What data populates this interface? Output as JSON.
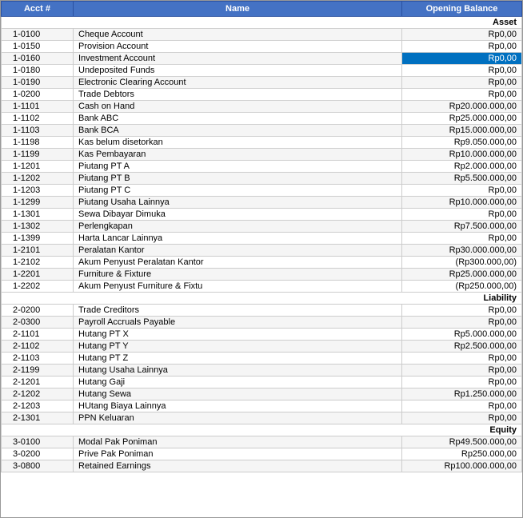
{
  "header": {
    "col1": "Acct #",
    "col2": "Name",
    "col3": "Opening Balance"
  },
  "rows": [
    {
      "type": "category",
      "col1": "Asset",
      "col2": "",
      "col3": ""
    },
    {
      "type": "data",
      "col1": "1-0100",
      "col2": "Cheque Account",
      "col3": "Rp0,00"
    },
    {
      "type": "data",
      "col1": "1-0150",
      "col2": "Provision Account",
      "col3": "Rp0,00"
    },
    {
      "type": "data",
      "col1": "1-0160",
      "col2": "Investment Account",
      "col3": "Rp0,00",
      "selected": true
    },
    {
      "type": "data",
      "col1": "1-0180",
      "col2": "Undeposited Funds",
      "col3": "Rp0,00"
    },
    {
      "type": "data",
      "col1": "1-0190",
      "col2": "Electronic Clearing Account",
      "col3": "Rp0,00"
    },
    {
      "type": "data",
      "col1": "1-0200",
      "col2": "Trade Debtors",
      "col3": "Rp0,00"
    },
    {
      "type": "data",
      "col1": "1-1101",
      "col2": "Cash on Hand",
      "col3": "Rp20.000.000,00"
    },
    {
      "type": "data",
      "col1": "1-1102",
      "col2": "Bank ABC",
      "col3": "Rp25.000.000,00"
    },
    {
      "type": "data",
      "col1": "1-1103",
      "col2": "Bank BCA",
      "col3": "Rp15.000.000,00"
    },
    {
      "type": "data",
      "col1": "1-1198",
      "col2": "Kas belum disetorkan",
      "col3": "Rp9.050.000,00"
    },
    {
      "type": "data",
      "col1": "1-1199",
      "col2": "Kas Pembayaran",
      "col3": "Rp10.000.000,00"
    },
    {
      "type": "data",
      "col1": "1-1201",
      "col2": "Piutang PT A",
      "col3": "Rp2.000.000,00"
    },
    {
      "type": "data",
      "col1": "1-1202",
      "col2": "Piutang PT B",
      "col3": "Rp5.500.000,00"
    },
    {
      "type": "data",
      "col1": "1-1203",
      "col2": "Piutang PT C",
      "col3": "Rp0,00"
    },
    {
      "type": "data",
      "col1": "1-1299",
      "col2": "Piutang Usaha Lainnya",
      "col3": "Rp10.000.000,00"
    },
    {
      "type": "data",
      "col1": "1-1301",
      "col2": "Sewa Dibayar Dimuka",
      "col3": "Rp0,00"
    },
    {
      "type": "data",
      "col1": "1-1302",
      "col2": "Perlengkapan",
      "col3": "Rp7.500.000,00"
    },
    {
      "type": "data",
      "col1": "1-1399",
      "col2": "Harta Lancar Lainnya",
      "col3": "Rp0,00"
    },
    {
      "type": "data",
      "col1": "1-2101",
      "col2": "Peralatan Kantor",
      "col3": "Rp30.000.000,00"
    },
    {
      "type": "data",
      "col1": "1-2102",
      "col2": "Akum Penyust Peralatan Kantor",
      "col3": "(Rp300.000,00)"
    },
    {
      "type": "data",
      "col1": "1-2201",
      "col2": "Furniture & Fixture",
      "col3": "Rp25.000.000,00"
    },
    {
      "type": "data",
      "col1": "1-2202",
      "col2": "Akum Penyust Furniture & Fixtu",
      "col3": "(Rp250.000,00)"
    },
    {
      "type": "category",
      "col1": "Liability",
      "col2": "",
      "col3": ""
    },
    {
      "type": "data",
      "col1": "2-0200",
      "col2": "Trade Creditors",
      "col3": "Rp0,00"
    },
    {
      "type": "data",
      "col1": "2-0300",
      "col2": "Payroll Accruals Payable",
      "col3": "Rp0,00"
    },
    {
      "type": "data",
      "col1": "2-1101",
      "col2": "Hutang PT X",
      "col3": "Rp5.000.000,00"
    },
    {
      "type": "data",
      "col1": "2-1102",
      "col2": "Hutang PT Y",
      "col3": "Rp2.500.000,00"
    },
    {
      "type": "data",
      "col1": "2-1103",
      "col2": "Hutang PT Z",
      "col3": "Rp0,00"
    },
    {
      "type": "data",
      "col1": "2-1199",
      "col2": "Hutang Usaha Lainnya",
      "col3": "Rp0,00"
    },
    {
      "type": "data",
      "col1": "2-1201",
      "col2": "Hutang Gaji",
      "col3": "Rp0,00"
    },
    {
      "type": "data",
      "col1": "2-1202",
      "col2": "Hutang Sewa",
      "col3": "Rp1.250.000,00"
    },
    {
      "type": "data",
      "col1": "2-1203",
      "col2": "HUtang Biaya Lainnya",
      "col3": "Rp0,00"
    },
    {
      "type": "data",
      "col1": "2-1301",
      "col2": "PPN Keluaran",
      "col3": "Rp0,00"
    },
    {
      "type": "category",
      "col1": "Equity",
      "col2": "",
      "col3": ""
    },
    {
      "type": "data",
      "col1": "3-0100",
      "col2": "Modal Pak Poniman",
      "col3": "Rp49.500.000,00"
    },
    {
      "type": "data",
      "col1": "3-0200",
      "col2": "Prive Pak Poniman",
      "col3": "Rp250.000,00"
    },
    {
      "type": "data",
      "col1": "3-0800",
      "col2": "Retained Earnings",
      "col3": "Rp100.000.000,00"
    }
  ]
}
